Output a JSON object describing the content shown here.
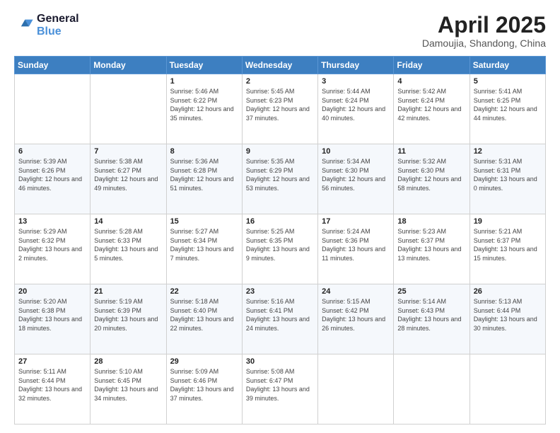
{
  "header": {
    "logo_line1": "General",
    "logo_line2": "Blue",
    "month": "April 2025",
    "location": "Damoujia, Shandong, China"
  },
  "weekdays": [
    "Sunday",
    "Monday",
    "Tuesday",
    "Wednesday",
    "Thursday",
    "Friday",
    "Saturday"
  ],
  "weeks": [
    [
      {
        "day": "",
        "sunrise": "",
        "sunset": "",
        "daylight": ""
      },
      {
        "day": "",
        "sunrise": "",
        "sunset": "",
        "daylight": ""
      },
      {
        "day": "1",
        "sunrise": "Sunrise: 5:46 AM",
        "sunset": "Sunset: 6:22 PM",
        "daylight": "Daylight: 12 hours and 35 minutes."
      },
      {
        "day": "2",
        "sunrise": "Sunrise: 5:45 AM",
        "sunset": "Sunset: 6:23 PM",
        "daylight": "Daylight: 12 hours and 37 minutes."
      },
      {
        "day": "3",
        "sunrise": "Sunrise: 5:44 AM",
        "sunset": "Sunset: 6:24 PM",
        "daylight": "Daylight: 12 hours and 40 minutes."
      },
      {
        "day": "4",
        "sunrise": "Sunrise: 5:42 AM",
        "sunset": "Sunset: 6:24 PM",
        "daylight": "Daylight: 12 hours and 42 minutes."
      },
      {
        "day": "5",
        "sunrise": "Sunrise: 5:41 AM",
        "sunset": "Sunset: 6:25 PM",
        "daylight": "Daylight: 12 hours and 44 minutes."
      }
    ],
    [
      {
        "day": "6",
        "sunrise": "Sunrise: 5:39 AM",
        "sunset": "Sunset: 6:26 PM",
        "daylight": "Daylight: 12 hours and 46 minutes."
      },
      {
        "day": "7",
        "sunrise": "Sunrise: 5:38 AM",
        "sunset": "Sunset: 6:27 PM",
        "daylight": "Daylight: 12 hours and 49 minutes."
      },
      {
        "day": "8",
        "sunrise": "Sunrise: 5:36 AM",
        "sunset": "Sunset: 6:28 PM",
        "daylight": "Daylight: 12 hours and 51 minutes."
      },
      {
        "day": "9",
        "sunrise": "Sunrise: 5:35 AM",
        "sunset": "Sunset: 6:29 PM",
        "daylight": "Daylight: 12 hours and 53 minutes."
      },
      {
        "day": "10",
        "sunrise": "Sunrise: 5:34 AM",
        "sunset": "Sunset: 6:30 PM",
        "daylight": "Daylight: 12 hours and 56 minutes."
      },
      {
        "day": "11",
        "sunrise": "Sunrise: 5:32 AM",
        "sunset": "Sunset: 6:30 PM",
        "daylight": "Daylight: 12 hours and 58 minutes."
      },
      {
        "day": "12",
        "sunrise": "Sunrise: 5:31 AM",
        "sunset": "Sunset: 6:31 PM",
        "daylight": "Daylight: 13 hours and 0 minutes."
      }
    ],
    [
      {
        "day": "13",
        "sunrise": "Sunrise: 5:29 AM",
        "sunset": "Sunset: 6:32 PM",
        "daylight": "Daylight: 13 hours and 2 minutes."
      },
      {
        "day": "14",
        "sunrise": "Sunrise: 5:28 AM",
        "sunset": "Sunset: 6:33 PM",
        "daylight": "Daylight: 13 hours and 5 minutes."
      },
      {
        "day": "15",
        "sunrise": "Sunrise: 5:27 AM",
        "sunset": "Sunset: 6:34 PM",
        "daylight": "Daylight: 13 hours and 7 minutes."
      },
      {
        "day": "16",
        "sunrise": "Sunrise: 5:25 AM",
        "sunset": "Sunset: 6:35 PM",
        "daylight": "Daylight: 13 hours and 9 minutes."
      },
      {
        "day": "17",
        "sunrise": "Sunrise: 5:24 AM",
        "sunset": "Sunset: 6:36 PM",
        "daylight": "Daylight: 13 hours and 11 minutes."
      },
      {
        "day": "18",
        "sunrise": "Sunrise: 5:23 AM",
        "sunset": "Sunset: 6:37 PM",
        "daylight": "Daylight: 13 hours and 13 minutes."
      },
      {
        "day": "19",
        "sunrise": "Sunrise: 5:21 AM",
        "sunset": "Sunset: 6:37 PM",
        "daylight": "Daylight: 13 hours and 15 minutes."
      }
    ],
    [
      {
        "day": "20",
        "sunrise": "Sunrise: 5:20 AM",
        "sunset": "Sunset: 6:38 PM",
        "daylight": "Daylight: 13 hours and 18 minutes."
      },
      {
        "day": "21",
        "sunrise": "Sunrise: 5:19 AM",
        "sunset": "Sunset: 6:39 PM",
        "daylight": "Daylight: 13 hours and 20 minutes."
      },
      {
        "day": "22",
        "sunrise": "Sunrise: 5:18 AM",
        "sunset": "Sunset: 6:40 PM",
        "daylight": "Daylight: 13 hours and 22 minutes."
      },
      {
        "day": "23",
        "sunrise": "Sunrise: 5:16 AM",
        "sunset": "Sunset: 6:41 PM",
        "daylight": "Daylight: 13 hours and 24 minutes."
      },
      {
        "day": "24",
        "sunrise": "Sunrise: 5:15 AM",
        "sunset": "Sunset: 6:42 PM",
        "daylight": "Daylight: 13 hours and 26 minutes."
      },
      {
        "day": "25",
        "sunrise": "Sunrise: 5:14 AM",
        "sunset": "Sunset: 6:43 PM",
        "daylight": "Daylight: 13 hours and 28 minutes."
      },
      {
        "day": "26",
        "sunrise": "Sunrise: 5:13 AM",
        "sunset": "Sunset: 6:44 PM",
        "daylight": "Daylight: 13 hours and 30 minutes."
      }
    ],
    [
      {
        "day": "27",
        "sunrise": "Sunrise: 5:11 AM",
        "sunset": "Sunset: 6:44 PM",
        "daylight": "Daylight: 13 hours and 32 minutes."
      },
      {
        "day": "28",
        "sunrise": "Sunrise: 5:10 AM",
        "sunset": "Sunset: 6:45 PM",
        "daylight": "Daylight: 13 hours and 34 minutes."
      },
      {
        "day": "29",
        "sunrise": "Sunrise: 5:09 AM",
        "sunset": "Sunset: 6:46 PM",
        "daylight": "Daylight: 13 hours and 37 minutes."
      },
      {
        "day": "30",
        "sunrise": "Sunrise: 5:08 AM",
        "sunset": "Sunset: 6:47 PM",
        "daylight": "Daylight: 13 hours and 39 minutes."
      },
      {
        "day": "",
        "sunrise": "",
        "sunset": "",
        "daylight": ""
      },
      {
        "day": "",
        "sunrise": "",
        "sunset": "",
        "daylight": ""
      },
      {
        "day": "",
        "sunrise": "",
        "sunset": "",
        "daylight": ""
      }
    ]
  ]
}
